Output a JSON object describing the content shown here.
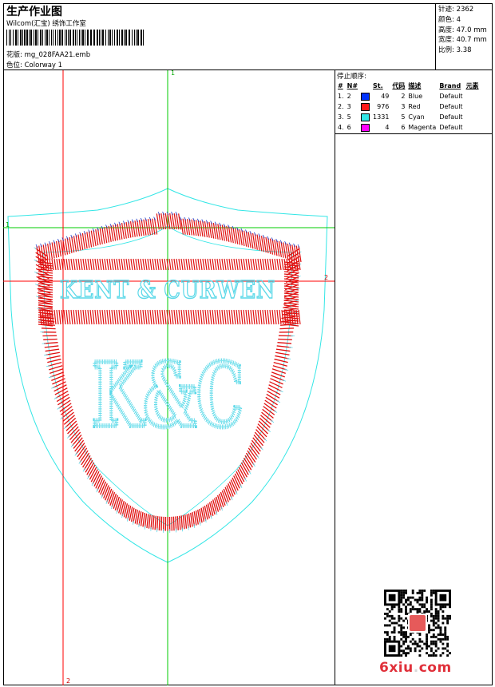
{
  "header": {
    "title": "生产作业图",
    "company": "Wilcom(汇宝) 绣饰工作室",
    "design_label": "花版:",
    "design_file": "mg_028FAA21.emb",
    "colorway_label": "色位:",
    "colorway_value": "Colorway 1"
  },
  "info": {
    "stitches_label": "针迹:",
    "stitches": "2362",
    "colors_label": "颜色:",
    "colors": "4",
    "height_label": "高度:",
    "height": "47.0 mm",
    "width_label": "宽度:",
    "width": "40.7 mm",
    "scale_label": "比例:",
    "scale": "3.38"
  },
  "stop_sequence": {
    "title": "停止顺序:",
    "headers": [
      "#",
      "N#",
      "St.",
      "代码",
      "描述",
      "Brand",
      "元素"
    ],
    "rows": [
      {
        "index": "1.",
        "n": "2",
        "stitches": "49",
        "code": "2",
        "desc": "Blue",
        "brand": "Default",
        "color": "#0033ff"
      },
      {
        "index": "2.",
        "n": "3",
        "stitches": "976",
        "code": "3",
        "desc": "Red",
        "brand": "Default",
        "color": "#ff1a1a"
      },
      {
        "index": "3.",
        "n": "5",
        "stitches": "1331",
        "code": "5",
        "desc": "Cyan",
        "brand": "Default",
        "color": "#33e6e6"
      },
      {
        "index": "4.",
        "n": "6",
        "stitches": "4",
        "code": "6",
        "desc": "Magenta",
        "brand": "Default",
        "color": "#ff00ff"
      }
    ]
  },
  "canvas": {
    "markers": {
      "top": "1",
      "left": "1",
      "right": "2",
      "bottom": "2"
    },
    "guide_green": "#00cc00",
    "guide_red": "#ff0000",
    "outline_cyan": "#33e6e6",
    "stitch_red": "#e01010",
    "stitch_cyan": "#5ad8e8",
    "stitch_blue": "#2244cc",
    "banner_text": "KENT & CURWEN",
    "monogram": "K&C"
  },
  "watermark": {
    "text_main": "6xiu",
    "text_dot": ".",
    "text_tld": "com"
  }
}
